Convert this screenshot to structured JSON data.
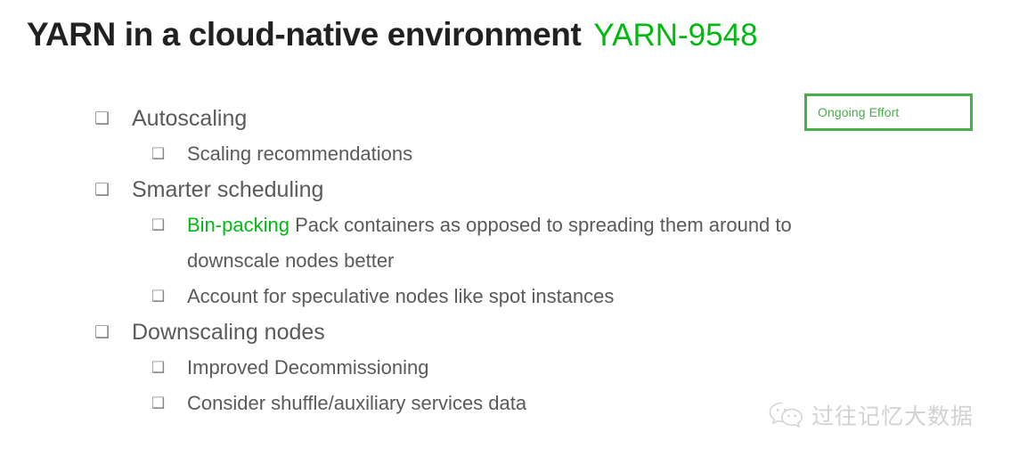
{
  "title": {
    "main": "YARN in a cloud-native environment",
    "reference": "YARN-9548",
    "main_color": "#212121",
    "reference_color": "#00b90f"
  },
  "badge": {
    "label": "Ongoing Effort",
    "border_color": "#49ad4a",
    "text_color": "#49ad4a"
  },
  "bullet_glyph": "❑",
  "accent_color": "#00bb12",
  "body_color": "#5a5a5a",
  "bullets": [
    {
      "level": 1,
      "text": "Autoscaling"
    },
    {
      "level": 2,
      "text": "Scaling recommendations"
    },
    {
      "level": 1,
      "text": "Smarter scheduling"
    },
    {
      "level": 2,
      "accent": "Bin-packing",
      "text": " Pack containers as opposed to spreading them around to downscale nodes better"
    },
    {
      "level": 2,
      "text": "Account for speculative nodes like spot instances"
    },
    {
      "level": 1,
      "text": "Downscaling nodes"
    },
    {
      "level": 2,
      "text": "Improved Decommissioning"
    },
    {
      "level": 2,
      "text": "Consider shuffle/auxiliary services data"
    }
  ],
  "watermark": {
    "icon": "wechat-logo-icon",
    "text": "过往记忆大数据",
    "color": "#b7b7b7"
  }
}
